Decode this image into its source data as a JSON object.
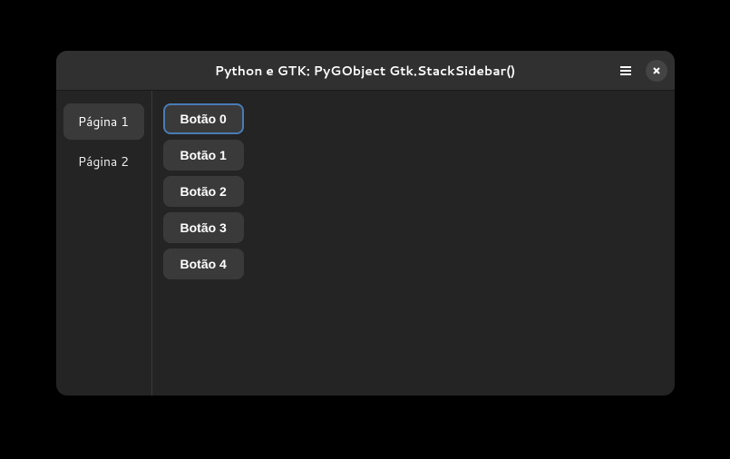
{
  "window": {
    "title": "Python e GTK: PyGObject Gtk.StackSidebar()"
  },
  "sidebar": {
    "items": [
      {
        "label": "Página 1",
        "active": true
      },
      {
        "label": "Página 2",
        "active": false
      }
    ]
  },
  "content": {
    "buttons": [
      {
        "label": "Botão 0",
        "focused": true
      },
      {
        "label": "Botão 1",
        "focused": false
      },
      {
        "label": "Botão 2",
        "focused": false
      },
      {
        "label": "Botão 3",
        "focused": false
      },
      {
        "label": "Botão 4",
        "focused": false
      }
    ]
  }
}
